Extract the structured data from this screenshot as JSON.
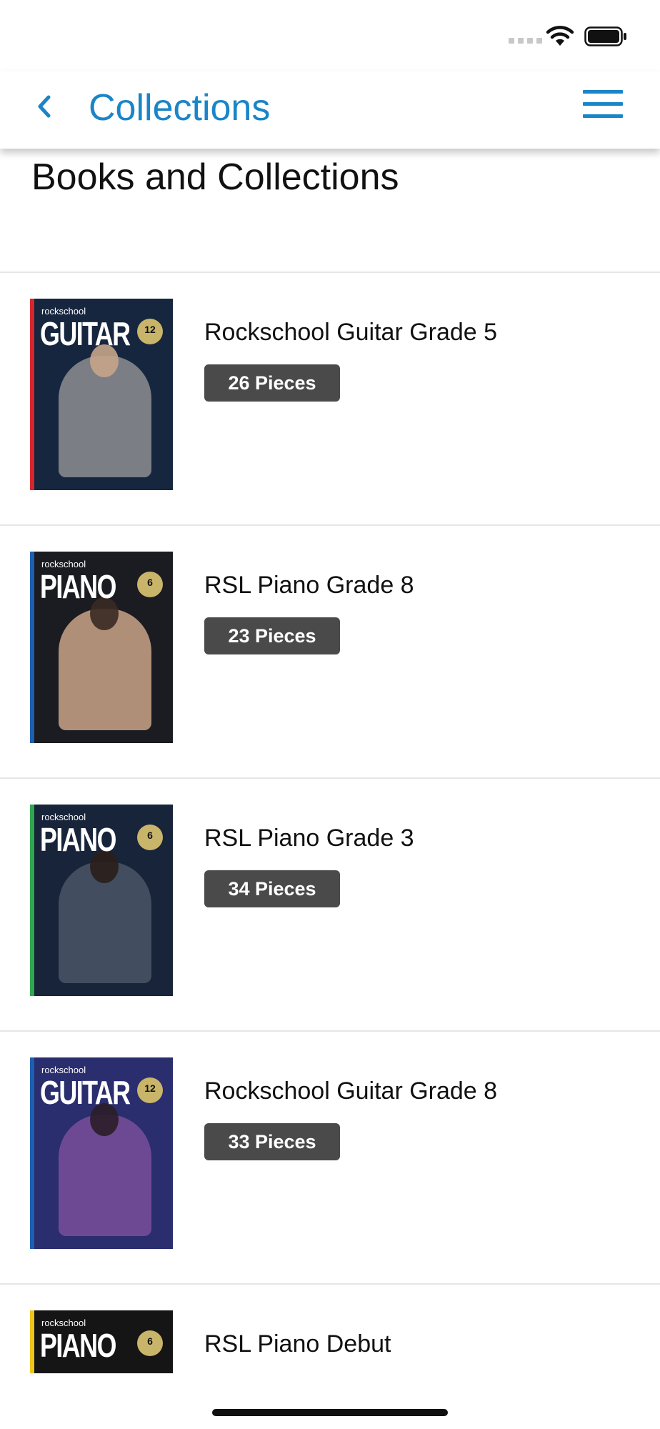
{
  "header": {
    "title": "Collections"
  },
  "page": {
    "heading": "Books and Collections"
  },
  "items": [
    {
      "title": "Rockschool Guitar Grade 5",
      "pieces": "26 Pieces",
      "cover": {
        "brand": "rockschool",
        "instrument": "GUITAR",
        "badge": "12",
        "stripe": "#d8262d",
        "bg": "#16263f",
        "figure": "#8d8e92"
      }
    },
    {
      "title": "RSL Piano Grade 8",
      "pieces": "23 Pieces",
      "cover": {
        "brand": "rockschool",
        "instrument": "PIANO",
        "badge": "6",
        "stripe": "#1d5fb0",
        "bg": "#1b1c22",
        "figure": "#c9a386"
      }
    },
    {
      "title": "RSL Piano Grade 3",
      "pieces": "34 Pieces",
      "cover": {
        "brand": "rockschool",
        "instrument": "PIANO",
        "badge": "6",
        "stripe": "#2fa84f",
        "bg": "#18243a",
        "figure": "#4a5566"
      }
    },
    {
      "title": "Rockschool Guitar Grade 8",
      "pieces": "33 Pieces",
      "cover": {
        "brand": "rockschool",
        "instrument": "GUITAR",
        "badge": "12",
        "stripe": "#1d5fb0",
        "bg": "#2a2d6e",
        "figure": "#7a4f9a"
      }
    },
    {
      "title": "RSL Piano Debut",
      "pieces": "",
      "cover": {
        "brand": "rockschool",
        "instrument": "PIANO",
        "badge": "6",
        "stripe": "#f0c419",
        "bg": "#151515",
        "figure": "#333333"
      }
    }
  ]
}
